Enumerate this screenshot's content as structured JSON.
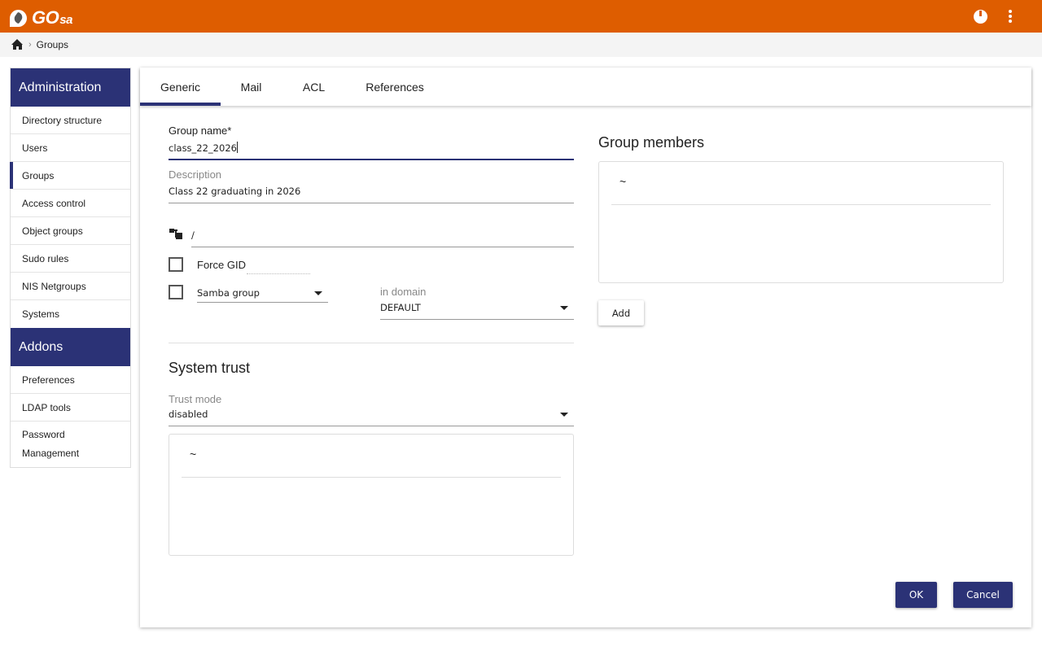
{
  "app": {
    "name_main": "GO",
    "name_sub": "sa",
    "brand_color": "#de5d00",
    "accent_color": "#2b3276"
  },
  "topbar": {
    "icons": [
      "power-icon",
      "kebab-menu-icon"
    ]
  },
  "breadcrumb": {
    "home_icon": "home-icon",
    "separator": "›",
    "current": "Groups"
  },
  "sidebar": {
    "sections": [
      {
        "title": "Administration",
        "items": [
          {
            "label": "Directory structure"
          },
          {
            "label": "Users"
          },
          {
            "label": "Groups",
            "active": true
          },
          {
            "label": "Access control"
          },
          {
            "label": "Object groups"
          },
          {
            "label": "Sudo rules"
          },
          {
            "label": "NIS Netgroups"
          },
          {
            "label": "Systems"
          }
        ]
      },
      {
        "title": "Addons",
        "items": [
          {
            "label": "Preferences"
          },
          {
            "label": "LDAP tools"
          },
          {
            "label": "Password",
            "label2": "Management"
          }
        ]
      }
    ]
  },
  "tabs": [
    {
      "label": "Generic",
      "active": true
    },
    {
      "label": "Mail"
    },
    {
      "label": "ACL"
    },
    {
      "label": "References"
    }
  ],
  "form": {
    "group_name": {
      "label": "Group name*",
      "value": "class_22_2026"
    },
    "description": {
      "label": "Description",
      "value": "Class 22 graduating in 2026"
    },
    "base": {
      "icon": "tree-structure-icon",
      "value": "/"
    },
    "force_gid": {
      "label": "Force GID",
      "checked": false,
      "value": ""
    },
    "samba_group": {
      "checked": false,
      "selected": "Samba group"
    },
    "domain": {
      "label": "in domain",
      "selected": "DEFAULT"
    },
    "system_trust": {
      "title": "System trust",
      "trust_mode_label": "Trust mode",
      "trust_mode_selected": "disabled",
      "list_placeholder": "~"
    },
    "group_members": {
      "title": "Group members",
      "list_placeholder": "~",
      "add_label": "Add"
    }
  },
  "actions": {
    "ok_label": "OK",
    "cancel_label": "Cancel"
  }
}
